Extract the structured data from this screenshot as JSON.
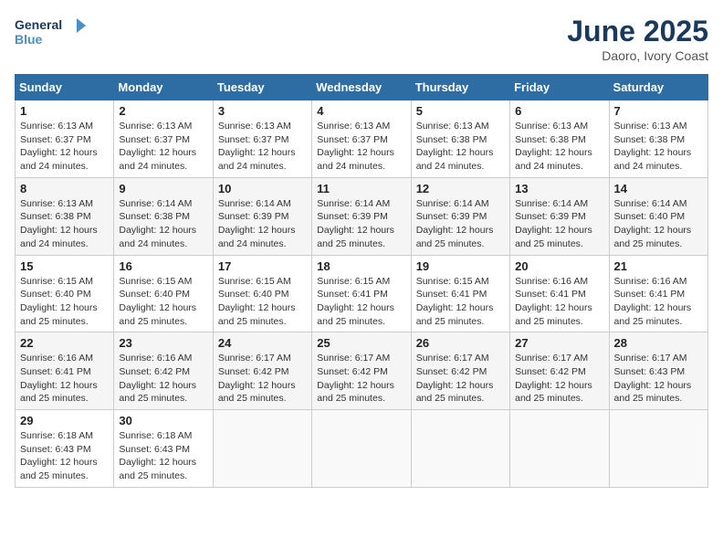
{
  "header": {
    "logo_line1": "General",
    "logo_line2": "Blue",
    "month": "June 2025",
    "location": "Daoro, Ivory Coast"
  },
  "days_of_week": [
    "Sunday",
    "Monday",
    "Tuesday",
    "Wednesday",
    "Thursday",
    "Friday",
    "Saturday"
  ],
  "weeks": [
    [
      {
        "day": "1",
        "sunrise": "6:13 AM",
        "sunset": "6:37 PM",
        "daylight": "12 hours and 24 minutes."
      },
      {
        "day": "2",
        "sunrise": "6:13 AM",
        "sunset": "6:37 PM",
        "daylight": "12 hours and 24 minutes."
      },
      {
        "day": "3",
        "sunrise": "6:13 AM",
        "sunset": "6:37 PM",
        "daylight": "12 hours and 24 minutes."
      },
      {
        "day": "4",
        "sunrise": "6:13 AM",
        "sunset": "6:37 PM",
        "daylight": "12 hours and 24 minutes."
      },
      {
        "day": "5",
        "sunrise": "6:13 AM",
        "sunset": "6:38 PM",
        "daylight": "12 hours and 24 minutes."
      },
      {
        "day": "6",
        "sunrise": "6:13 AM",
        "sunset": "6:38 PM",
        "daylight": "12 hours and 24 minutes."
      },
      {
        "day": "7",
        "sunrise": "6:13 AM",
        "sunset": "6:38 PM",
        "daylight": "12 hours and 24 minutes."
      }
    ],
    [
      {
        "day": "8",
        "sunrise": "6:13 AM",
        "sunset": "6:38 PM",
        "daylight": "12 hours and 24 minutes."
      },
      {
        "day": "9",
        "sunrise": "6:14 AM",
        "sunset": "6:38 PM",
        "daylight": "12 hours and 24 minutes."
      },
      {
        "day": "10",
        "sunrise": "6:14 AM",
        "sunset": "6:39 PM",
        "daylight": "12 hours and 24 minutes."
      },
      {
        "day": "11",
        "sunrise": "6:14 AM",
        "sunset": "6:39 PM",
        "daylight": "12 hours and 25 minutes."
      },
      {
        "day": "12",
        "sunrise": "6:14 AM",
        "sunset": "6:39 PM",
        "daylight": "12 hours and 25 minutes."
      },
      {
        "day": "13",
        "sunrise": "6:14 AM",
        "sunset": "6:39 PM",
        "daylight": "12 hours and 25 minutes."
      },
      {
        "day": "14",
        "sunrise": "6:14 AM",
        "sunset": "6:40 PM",
        "daylight": "12 hours and 25 minutes."
      }
    ],
    [
      {
        "day": "15",
        "sunrise": "6:15 AM",
        "sunset": "6:40 PM",
        "daylight": "12 hours and 25 minutes."
      },
      {
        "day": "16",
        "sunrise": "6:15 AM",
        "sunset": "6:40 PM",
        "daylight": "12 hours and 25 minutes."
      },
      {
        "day": "17",
        "sunrise": "6:15 AM",
        "sunset": "6:40 PM",
        "daylight": "12 hours and 25 minutes."
      },
      {
        "day": "18",
        "sunrise": "6:15 AM",
        "sunset": "6:41 PM",
        "daylight": "12 hours and 25 minutes."
      },
      {
        "day": "19",
        "sunrise": "6:15 AM",
        "sunset": "6:41 PM",
        "daylight": "12 hours and 25 minutes."
      },
      {
        "day": "20",
        "sunrise": "6:16 AM",
        "sunset": "6:41 PM",
        "daylight": "12 hours and 25 minutes."
      },
      {
        "day": "21",
        "sunrise": "6:16 AM",
        "sunset": "6:41 PM",
        "daylight": "12 hours and 25 minutes."
      }
    ],
    [
      {
        "day": "22",
        "sunrise": "6:16 AM",
        "sunset": "6:41 PM",
        "daylight": "12 hours and 25 minutes."
      },
      {
        "day": "23",
        "sunrise": "6:16 AM",
        "sunset": "6:42 PM",
        "daylight": "12 hours and 25 minutes."
      },
      {
        "day": "24",
        "sunrise": "6:17 AM",
        "sunset": "6:42 PM",
        "daylight": "12 hours and 25 minutes."
      },
      {
        "day": "25",
        "sunrise": "6:17 AM",
        "sunset": "6:42 PM",
        "daylight": "12 hours and 25 minutes."
      },
      {
        "day": "26",
        "sunrise": "6:17 AM",
        "sunset": "6:42 PM",
        "daylight": "12 hours and 25 minutes."
      },
      {
        "day": "27",
        "sunrise": "6:17 AM",
        "sunset": "6:42 PM",
        "daylight": "12 hours and 25 minutes."
      },
      {
        "day": "28",
        "sunrise": "6:17 AM",
        "sunset": "6:43 PM",
        "daylight": "12 hours and 25 minutes."
      }
    ],
    [
      {
        "day": "29",
        "sunrise": "6:18 AM",
        "sunset": "6:43 PM",
        "daylight": "12 hours and 25 minutes."
      },
      {
        "day": "30",
        "sunrise": "6:18 AM",
        "sunset": "6:43 PM",
        "daylight": "12 hours and 25 minutes."
      },
      null,
      null,
      null,
      null,
      null
    ]
  ]
}
